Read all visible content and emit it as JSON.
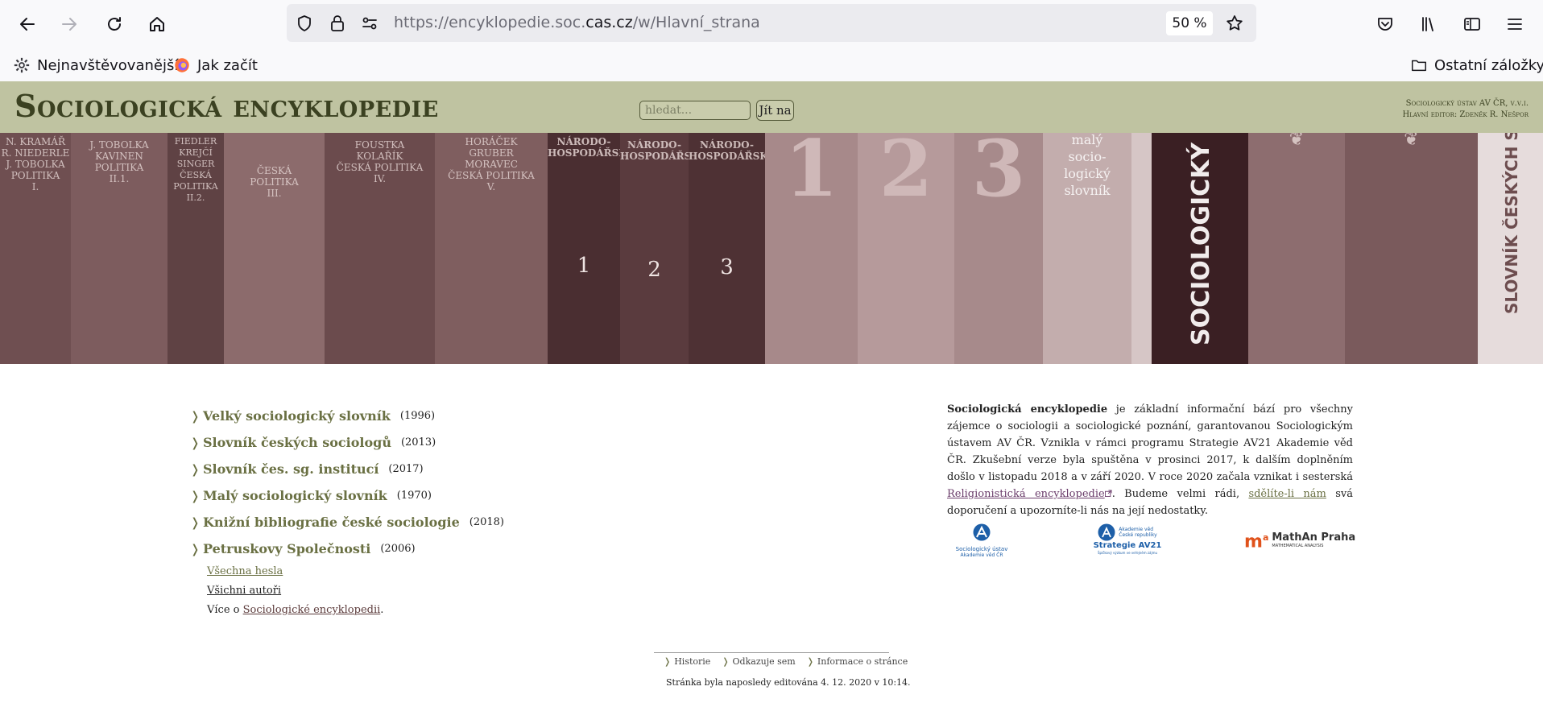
{
  "browser": {
    "url_prefix": "https://encyklopedie.soc.",
    "url_domain": "cas.cz",
    "url_path": "/w/Hlavní_strana",
    "zoom": "50 %",
    "bookmarks": [
      {
        "label": "Nejnavštěvovanější",
        "icon": "gear-icon"
      },
      {
        "label": "Jak začít",
        "icon": "firefox-icon"
      }
    ],
    "other_bookmarks": "Ostatní záložky"
  },
  "header": {
    "title": "Sociologická encyklopedie",
    "search_placeholder": "hledat...",
    "go_label": "Jít na",
    "institute": "Sociologický ústav AV ČR, v.v.i.",
    "editor": "Hlavní editor: Zdeněk R. Nešpor"
  },
  "banner": {
    "spines": [
      "N. KRAMÁŘ\nR. NIEDERLE\nJ. TOBOLKA\nPOLITIKA\nI.",
      "J. TOBOLKA\nKAVINEN\nPOLITIKA\nII.1.",
      "FIEDLER\nKREJČÍ\nSINGER\nČESKÁ\nPOLITIKA\nII.2.",
      "ČESKÁ\nPOLITIKA\nIII.",
      "FOUSTKA\nKOLAŘÍK\nČESKÁ POLITIKA\nIV.",
      "HORÁČEK\nGRUBER\nMORAVEC\nČESKÁ POLITIKA\nV."
    ],
    "volumes": [
      {
        "title": "NÁRODO-\nHOSPODÁŘSKÝ",
        "number": "1"
      },
      {
        "title": "NÁRODO-\nHOSPODÁŘSKÝ",
        "number": "2"
      },
      {
        "title": "NÁRODO-\nHOSPODÁŘSKÝ",
        "number": "3"
      }
    ],
    "big_numbers": [
      "1",
      "2",
      "3"
    ],
    "small_dictionary": "malý\nsocio-\nlogický\nslovník",
    "vertical_title_1": "SOCIOLOGICKÝ SLO",
    "vertical_title_2": "SLOVNÍK ČESKÝCH SOCIO"
  },
  "main": {
    "links": [
      {
        "name": "Velký sociologický slovník",
        "year": "(1996)"
      },
      {
        "name": "Slovník českých sociologů",
        "year": "(2013)"
      },
      {
        "name": "Slovník čes. sg. institucí",
        "year": "(2017)"
      },
      {
        "name": "Malý sociologický slovník",
        "year": "(1970)"
      },
      {
        "name": "Knižní bibliografie české sociologie",
        "year": "(2018)"
      },
      {
        "name": "Petruskovy Společnosti",
        "year": "(2006)"
      }
    ],
    "all_entries": "Všechna hesla",
    "all_authors": "Všichni autoři",
    "more_prefix": "Více o ",
    "more_link": "Sociologické encyklopedii",
    "more_suffix": "."
  },
  "intro": {
    "bold": "Sociologická encyklopedie",
    "text1": " je základní informační bází pro všechny zájemce o sociologii a sociologické poznání, garantovanou Sociologickým ústavem AV ČR. Vznikla v rámci programu Strategie AV21 Akademie věd ČR. Zkušební verze byla spuštěna v prosinci 2017, k dalším doplněním došlo v listopadu 2018 a v září 2020. V roce 2020 začala vznikat i sesterská ",
    "ext_link": "Religionistická encyklopedie",
    "text2": ". Budeme velmi rádi, ",
    "contact_link": "sdělíte-li nám",
    "text3": " svá doporučení a upozorníte-li nás na její nedostatky."
  },
  "logos": {
    "soc_line1": "Sociologický ústav",
    "soc_line2": "Akademie věd ČR",
    "av_line1": "Akademie věd",
    "av_line2": "České republiky",
    "av_line3": "Strategie AV21",
    "av_line4": "Špičkový výzkum ve veřejném zájmu",
    "mathan": "MathAn Praha",
    "mathan_sub": "MATHEMATICAL ANALYSIS",
    "mathan_mark": "m",
    "mathan_sup": "a"
  },
  "footer": {
    "links": [
      "Historie",
      "Odkazuje sem",
      "Informace o stránce"
    ],
    "last_edited": "Stránka byla naposledy editována 4. 12. 2020 v 10:14."
  },
  "colors": {
    "header_bg": "#bfc3a1",
    "title": "#3b4121",
    "link_green": "#6a7043",
    "banner": "#6d4d4f"
  }
}
